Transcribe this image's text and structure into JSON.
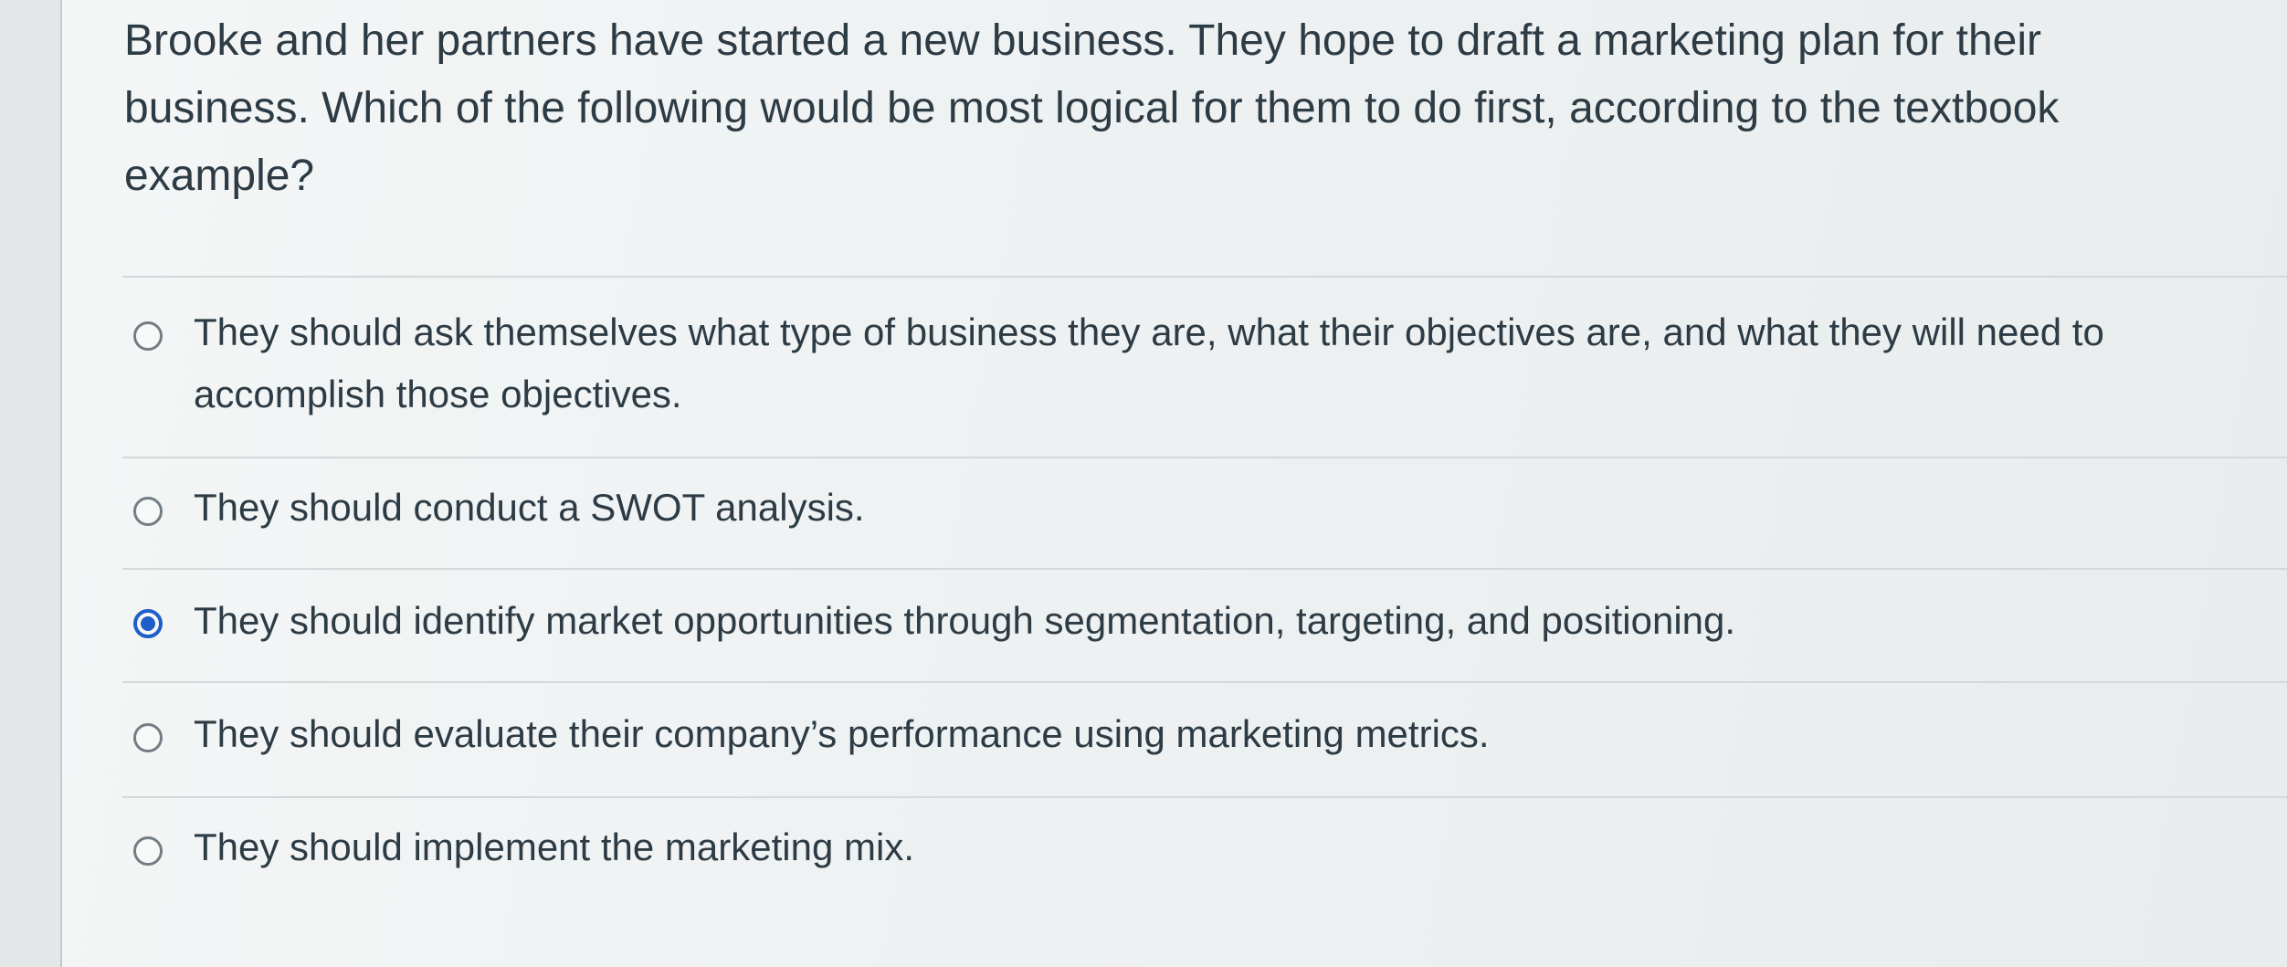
{
  "question": {
    "text": "Brooke and her partners have started a new business. They hope to draft a marketing plan for their business. Which of the following would be most logical for them to do first, according to the textbook example?"
  },
  "options": [
    {
      "label": "They should ask themselves what type of business they are, what their objectives are, and what they will need to accomplish those objectives.",
      "selected": false
    },
    {
      "label": "They should conduct a SWOT analysis.",
      "selected": false
    },
    {
      "label": "They should identify market opportunities through segmentation, targeting, and positioning.",
      "selected": true
    },
    {
      "label": "They should evaluate their company’s performance using marketing metrics.",
      "selected": false
    },
    {
      "label": "They should implement the marketing mix.",
      "selected": false
    }
  ],
  "colors": {
    "text": "#2d3b45",
    "radio_selected": "#1f5ec9",
    "radio_unselected": "#737d84",
    "divider": "#d3d8da"
  }
}
